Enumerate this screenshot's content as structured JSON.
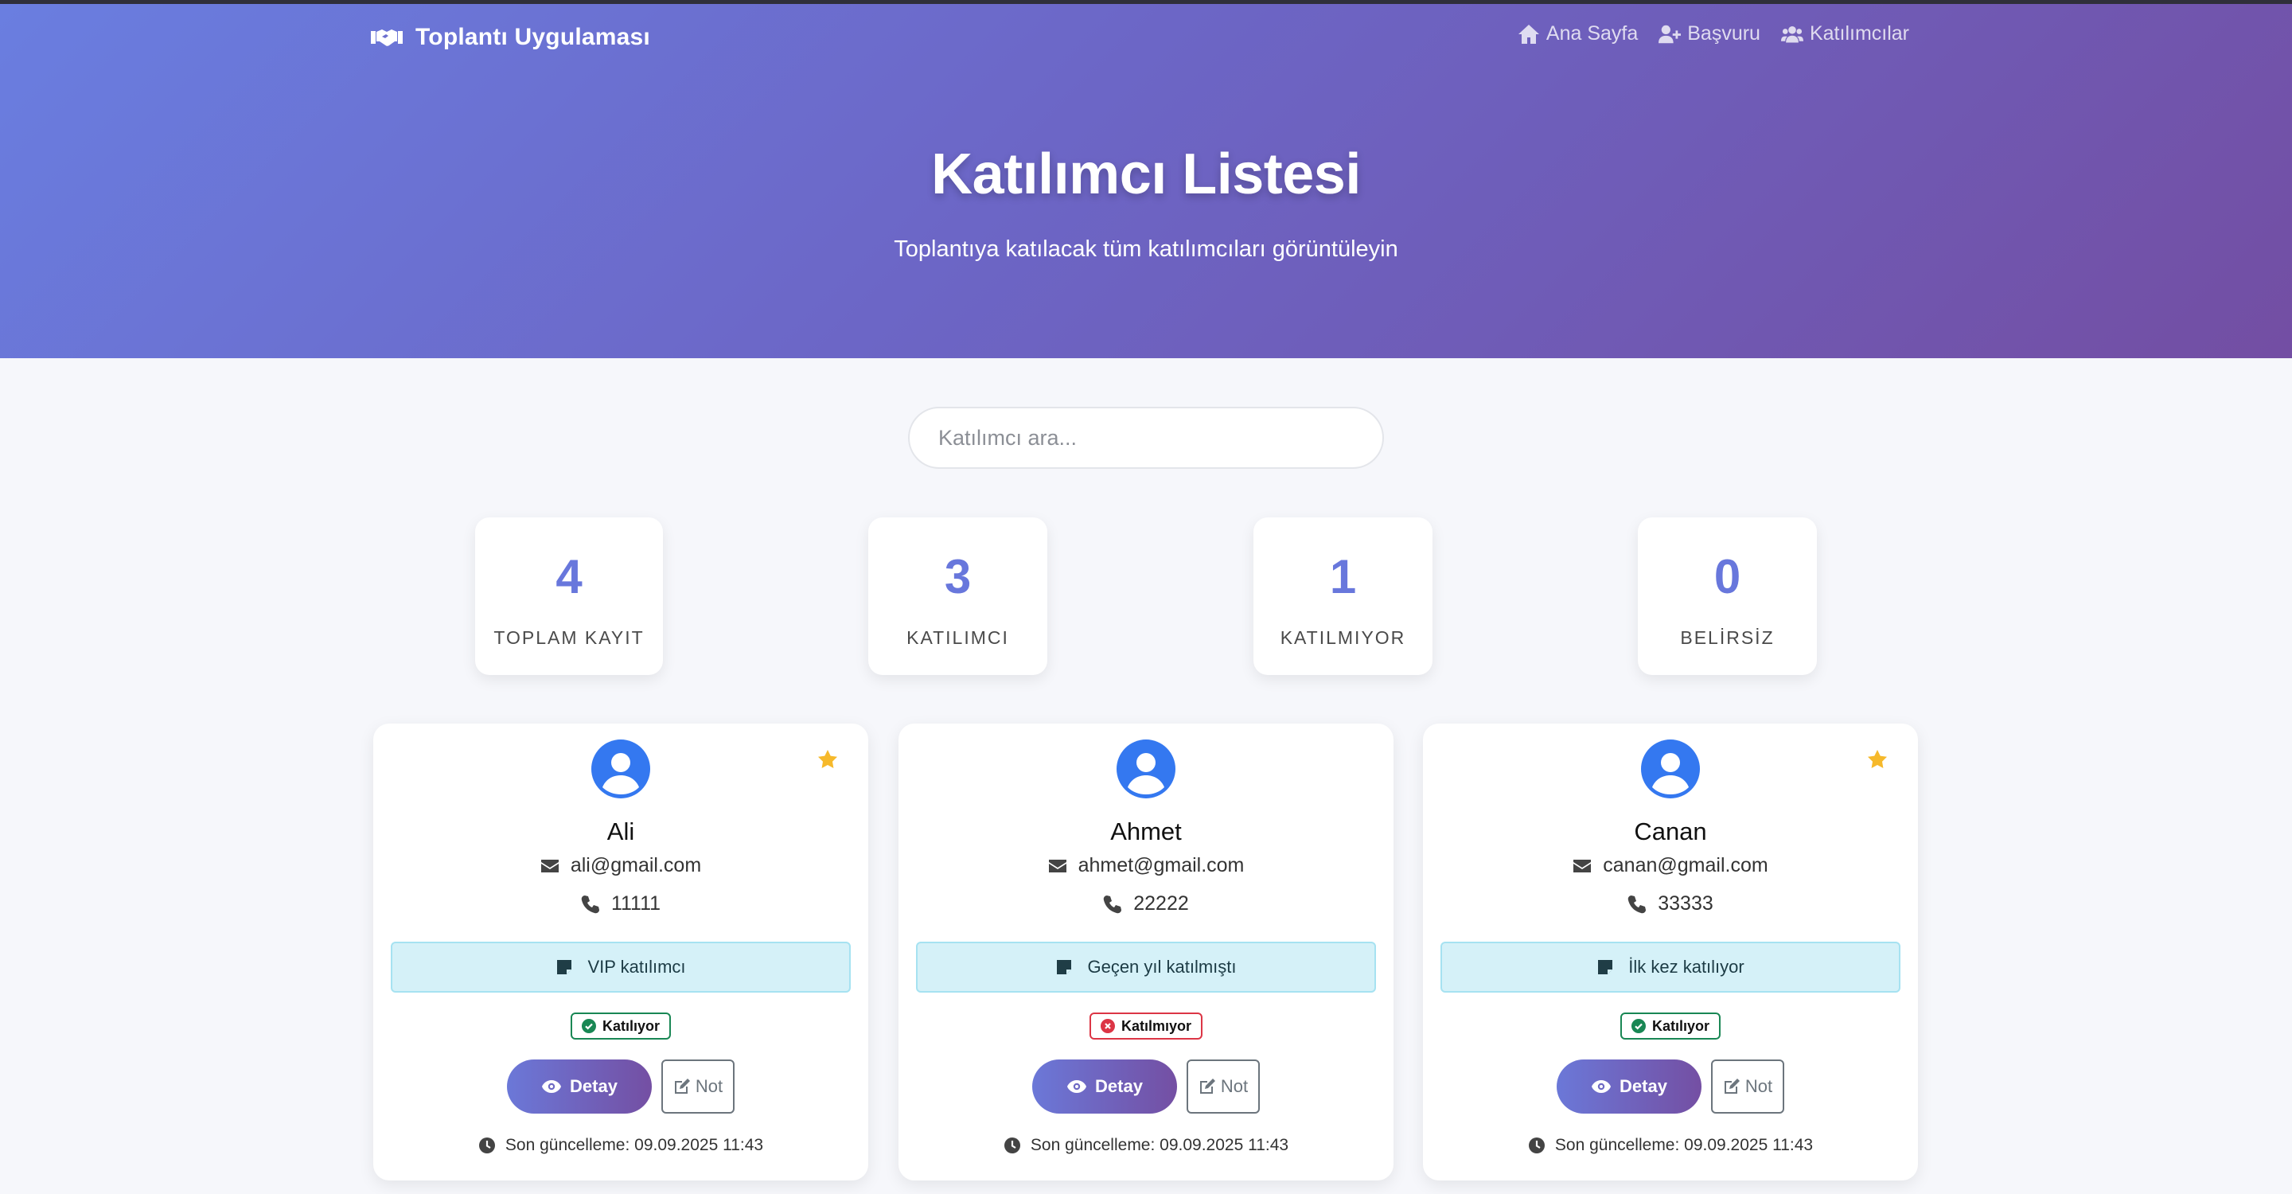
{
  "app": {
    "title": "Toplantı Uygulaması",
    "icon": "handshake-icon"
  },
  "nav": {
    "items": [
      {
        "label": "Ana Sayfa",
        "icon": "home-icon"
      },
      {
        "label": "Başvuru",
        "icon": "user-plus-icon"
      },
      {
        "label": "Katılımcılar",
        "icon": "users-icon"
      }
    ]
  },
  "hero": {
    "title": "Katılımcı Listesi",
    "subtitle": "Toplantıya katılacak tüm katılımcıları görüntüleyin"
  },
  "search": {
    "placeholder": "Katılımcı ara...",
    "value": ""
  },
  "stats": [
    {
      "value": "4",
      "label": "TOPLAM KAYIT"
    },
    {
      "value": "3",
      "label": "KATILIMCI"
    },
    {
      "value": "1",
      "label": "KATILMIYOR"
    },
    {
      "value": "0",
      "label": "BELİRSİZ"
    }
  ],
  "participants": [
    {
      "name": "Ali",
      "email": "ali@gmail.com",
      "phone": "11111",
      "note": "VIP katılımcı",
      "status": "Katılıyor",
      "status_color": "#198754",
      "starred": true,
      "detail_label": "Detay",
      "note_button_label": "Not",
      "updated": "Son güncelleme: 09.09.2025 11:43"
    },
    {
      "name": "Ahmet",
      "email": "ahmet@gmail.com",
      "phone": "22222",
      "note": "Geçen yıl katılmıştı",
      "status": "Katılmıyor",
      "status_color": "#dc3545",
      "starred": false,
      "detail_label": "Detay",
      "note_button_label": "Not",
      "updated": "Son güncelleme: 09.09.2025 11:43"
    },
    {
      "name": "Canan",
      "email": "canan@gmail.com",
      "phone": "33333",
      "note": "İlk kez katılıyor",
      "status": "Katılıyor",
      "status_color": "#198754",
      "starred": true,
      "detail_label": "Detay",
      "note_button_label": "Not",
      "updated": "Son güncelleme: 09.09.2025 11:43"
    }
  ],
  "colors": {
    "accent": "#6877dc",
    "hero_start": "#6a7ee0",
    "hero_end": "#734ea3",
    "avatar": "#3478f0",
    "star": "#f6b92b",
    "note_bg": "#d5f1f8"
  }
}
